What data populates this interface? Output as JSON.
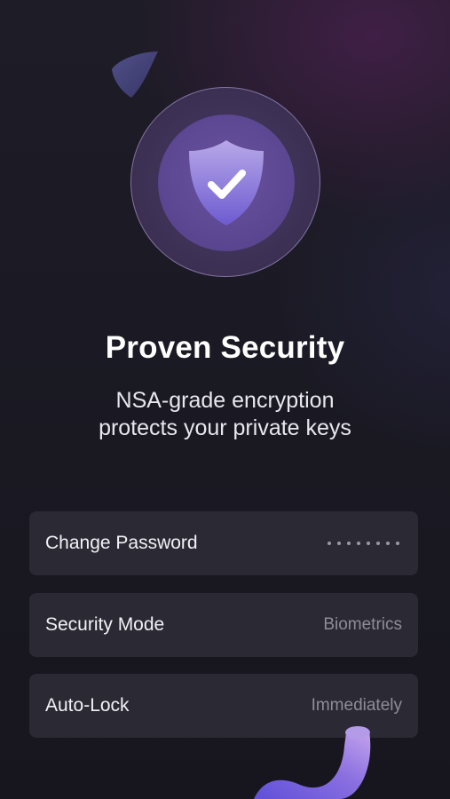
{
  "hero": {
    "icon": "shield-check-icon",
    "title": "Proven Security",
    "subtitle_lines": [
      "NSA-grade encryption",
      "protects your private keys"
    ]
  },
  "settings": [
    {
      "label": "Change Password",
      "value": "••••••••",
      "value_display": "masked-dots"
    },
    {
      "label": "Security Mode",
      "value": "Biometrics"
    },
    {
      "label": "Auto-Lock",
      "value": "Immediately"
    }
  ],
  "colors": {
    "background": "#1b1a24",
    "accent_purple": "#6a52a0",
    "row_background": "#2b2a34",
    "value_text": "#8e8c98"
  }
}
